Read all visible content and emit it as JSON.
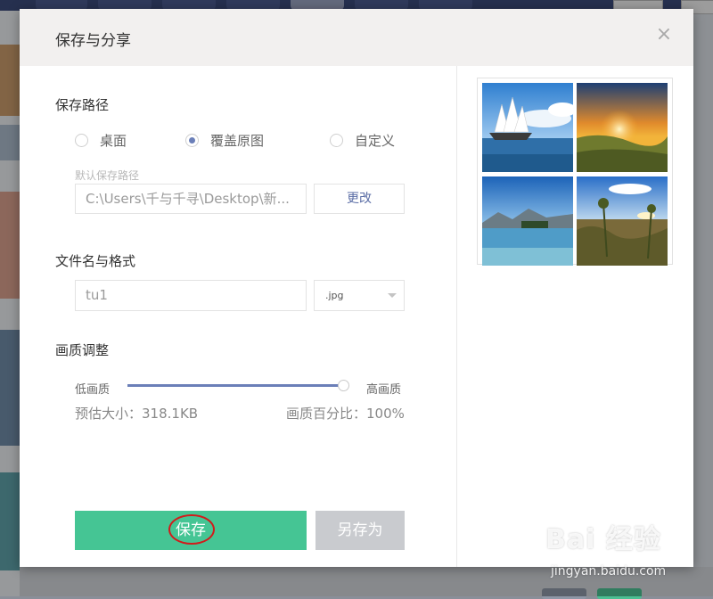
{
  "dialog": {
    "title": "保存与分享",
    "close_symbol": "×",
    "save_path": {
      "label": "保存路径",
      "options": [
        {
          "label": "桌面",
          "checked": false
        },
        {
          "label": "覆盖原图",
          "checked": true
        },
        {
          "label": "自定义",
          "checked": false
        }
      ],
      "default_hint": "默认保存路径",
      "path_value": "C:\\Users\\千与千寻\\Desktop\\新...",
      "change_button": "更改"
    },
    "file": {
      "label": "文件名与格式",
      "filename_value": "tu1",
      "format_value": ".jpg"
    },
    "quality": {
      "label": "画质调整",
      "low_label": "低画质",
      "high_label": "高画质",
      "slider_percent": 100,
      "size_estimate": "预估大小：318.1KB",
      "quality_percent_text": "画质百分比：100%"
    },
    "buttons": {
      "save": "保存",
      "save_as": "另存为"
    },
    "colors": {
      "accent": "#6b7fb8",
      "save_green": "#45c594",
      "highlight_red": "#d21b1b"
    }
  },
  "watermark": {
    "brand": "Bai 经验",
    "url": "jingyan.baidu.com"
  }
}
